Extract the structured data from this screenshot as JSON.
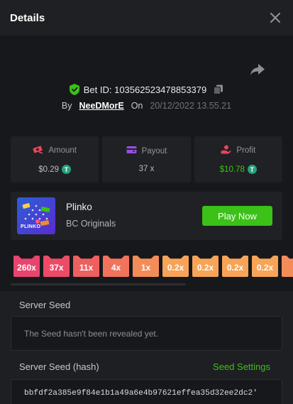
{
  "header": {
    "title": "Details"
  },
  "bet": {
    "id_text": "Bet ID: 103562523478853379",
    "by_label": "By",
    "user": "NeeDMorE",
    "on_label": "On",
    "date": "20/12/2022 13.55.21"
  },
  "stats": [
    {
      "label": "Amount",
      "value": "$0.29",
      "icon": "money-icon",
      "color": "#e8455f"
    },
    {
      "label": "Payout",
      "value": "37 x",
      "icon": "wallet-icon",
      "color": "#9a4fe0"
    },
    {
      "label": "Profit",
      "value": "$10.78",
      "icon": "profit-hand-icon",
      "color": "#e8455f"
    }
  ],
  "game": {
    "name": "Plinko",
    "provider": "BC Originals",
    "play_label": "Play Now",
    "thumb_text": "PLINKO"
  },
  "multipliers": [
    {
      "label": "260x",
      "color": "#e8456e"
    },
    {
      "label": "37x",
      "color": "#ec4b68"
    },
    {
      "label": "11x",
      "color": "#ee5f60"
    },
    {
      "label": "4x",
      "color": "#f1735c"
    },
    {
      "label": "1x",
      "color": "#f48c58"
    },
    {
      "label": "0.2x",
      "color": "#f7a458"
    },
    {
      "label": "0.2x",
      "color": "#f7a458"
    },
    {
      "label": "0.2x",
      "color": "#f7a458"
    },
    {
      "label": "0.2x",
      "color": "#f7a458"
    },
    {
      "label": "",
      "color": "#f48c58"
    }
  ],
  "seed": {
    "server_seed_label": "Server Seed",
    "server_seed_value": "The Seed hasn't been revealed yet.",
    "hash_label": "Server Seed (hash)",
    "settings_label": "Seed Settings",
    "hash_value": "bbfdf2a385e9f84e1b1a49a6e4b97621effea35d32ee2dc2'"
  },
  "colors": {
    "accent_green": "#3bc117",
    "bg": "#17181b",
    "panel": "#202124"
  }
}
